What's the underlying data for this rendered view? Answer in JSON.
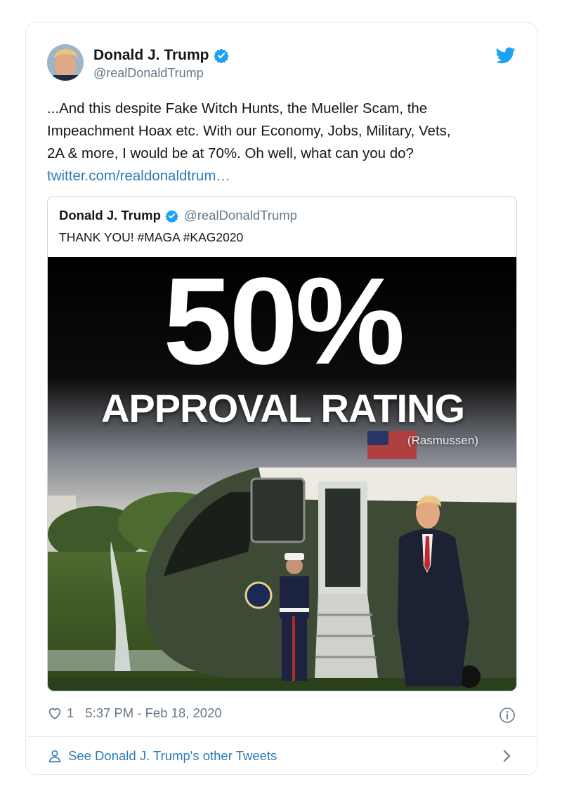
{
  "tweet": {
    "author_name": "Donald J. Trump",
    "author_handle": "@realDonaldTrump",
    "text_lines": [
      "...And this despite Fake Witch Hunts, the Mueller Scam, the",
      "Impeachment Hoax etc. With our Economy, Jobs, Military, Vets,",
      "2A & more, I would be at 70%. Oh well, what can you do?"
    ],
    "link": "twitter.com/realdonaldtrum…",
    "like_count": "1",
    "timestamp": "5:37 PM - Feb 18, 2020"
  },
  "quoted": {
    "author_name": "Donald J. Trump",
    "author_handle": "@realDonaldTrump",
    "text": "THANK YOU! #MAGA #KAG2020",
    "image": {
      "headline": "50%",
      "subheadline": "APPROVAL RATING",
      "source": "(Rasmussen)"
    }
  },
  "footer": {
    "label": "See Donald J. Trump's other Tweets"
  },
  "icons": {
    "verified": "verified-badge-icon",
    "brand": "twitter-bird-icon",
    "like": "heart-icon",
    "info": "info-icon",
    "profile": "person-icon",
    "more": "chevron-right-icon"
  },
  "colors": {
    "brand_blue": "#1da1f2",
    "link_blue": "#2b7bb9",
    "muted": "#657786",
    "border": "#e1e8ed"
  }
}
